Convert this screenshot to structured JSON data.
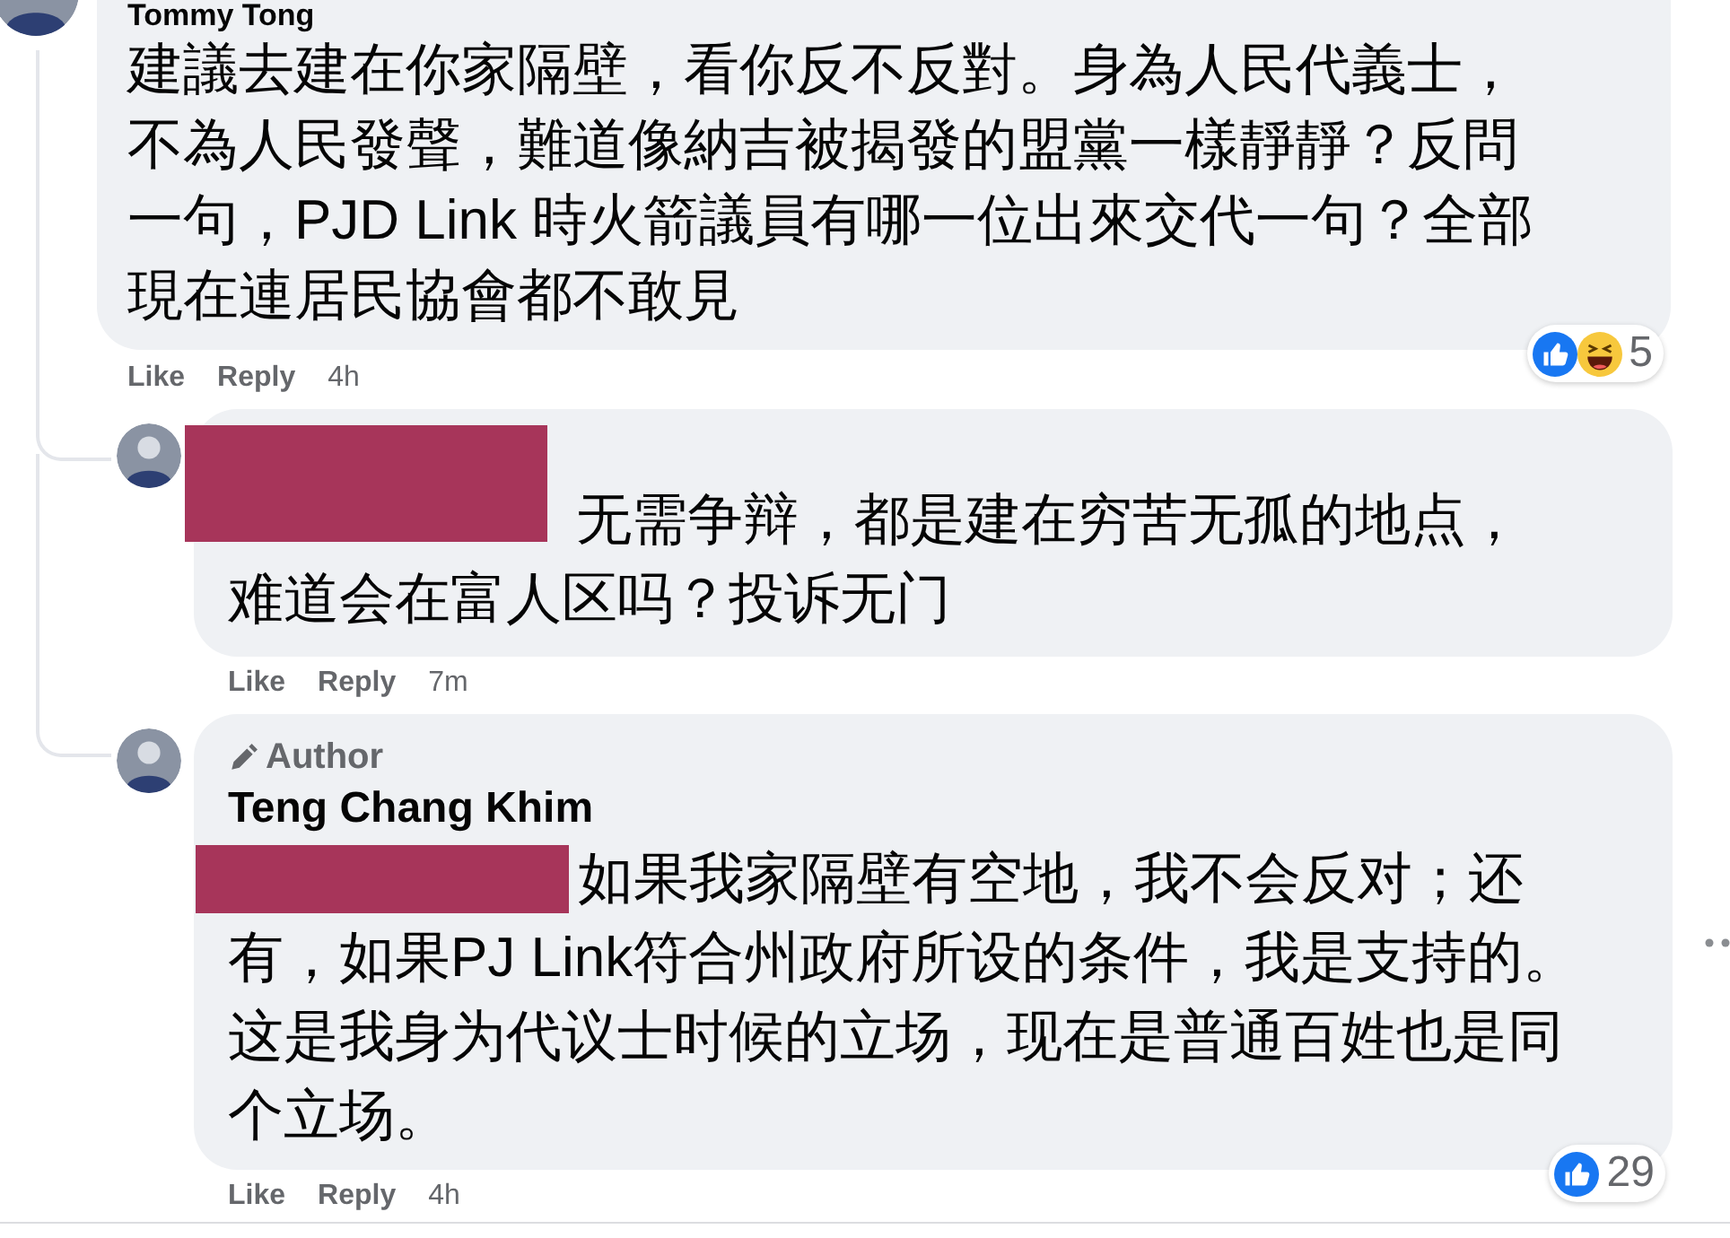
{
  "comments": [
    {
      "kind": "top",
      "author": "Tommy Tong",
      "lines": [
        "建議去建在你家隔壁，看你反不反對。身為人民代義士，",
        "不為人民發聲，難道像納吉被揭發的盟黨一樣靜靜？反問",
        "一句，PJD Link 時火箭議員有哪一位出來交代一句？全部",
        "現在連居民協會都不敢見"
      ],
      "actions": [
        "Like",
        "Reply"
      ],
      "time": "4h",
      "reactions": {
        "icons": [
          {
            "kind": "like"
          },
          {
            "kind": "haha"
          }
        ],
        "count": "5"
      }
    },
    {
      "kind": "reply",
      "name_redacted": true,
      "lines": [
        "无需争辩，都是建在穷苦无孤的地点，",
        "难道会在富人区吗？投诉无门"
      ],
      "actions": [
        "Like",
        "Reply"
      ],
      "time": "7m"
    },
    {
      "kind": "reply",
      "text_redacted": true,
      "badge": "Author",
      "author": "Teng Chang Khim",
      "lines": [
        "如果我家隔壁有空地，我不会反对；还",
        "有，如果PJ Link符合州政府所设的条件，我是支持的。",
        "这是我身为代议士时候的立场，现在是普通百姓也是同",
        "个立场。"
      ],
      "actions": [
        "Like",
        "Reply"
      ],
      "time": "4h",
      "reactions": {
        "icons": [
          {
            "kind": "like"
          }
        ],
        "count": "29"
      },
      "more_menu": true
    }
  ]
}
